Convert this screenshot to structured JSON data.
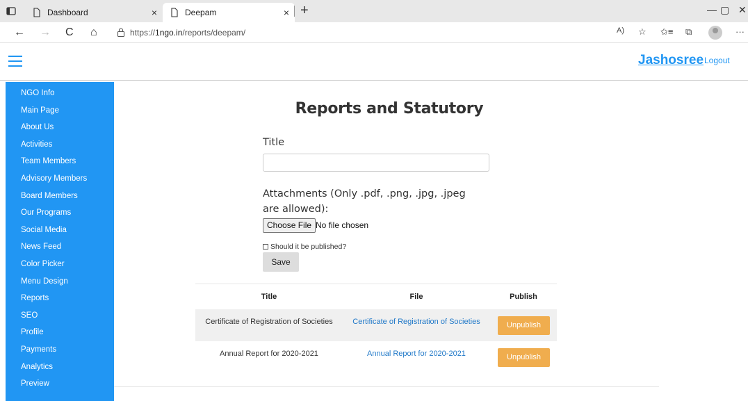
{
  "browser": {
    "tabs": [
      {
        "label": "Dashboard",
        "active": false
      },
      {
        "label": "Deepam",
        "active": true
      }
    ],
    "url_prefix": "https://",
    "url_domain": "1ngo.in",
    "url_path": "/reports/deepam/",
    "read_aloud": "A)",
    "glyphs": {
      "close": "×",
      "newtab": "+",
      "back": "←",
      "forward": "→",
      "reload": "C",
      "home": "⌂",
      "minimize": "—",
      "restore": "▢",
      "win_close": "✕",
      "favorite": "☆",
      "favorites": "✩≡",
      "collections": "⧉",
      "more": "···"
    }
  },
  "header": {
    "username": "Jashosree",
    "logout_label": "Logout"
  },
  "sidebar": {
    "items": [
      {
        "label": "NGO Info"
      },
      {
        "label": "Main Page"
      },
      {
        "label": "About Us"
      },
      {
        "label": "Activities"
      },
      {
        "label": "Team Members"
      },
      {
        "label": "Advisory Members"
      },
      {
        "label": "Board Members"
      },
      {
        "label": "Our Programs"
      },
      {
        "label": "Social Media"
      },
      {
        "label": "News Feed"
      },
      {
        "label": "Color Picker"
      },
      {
        "label": "Menu Design"
      },
      {
        "label": "Reports"
      },
      {
        "label": "SEO"
      },
      {
        "label": "Profile"
      },
      {
        "label": "Payments"
      },
      {
        "label": "Analytics"
      },
      {
        "label": "Preview"
      }
    ]
  },
  "main": {
    "page_title": "Reports and Statutory",
    "form": {
      "title_label": "Title",
      "title_value": "",
      "attachments_label": "Attachments (Only .pdf, .png, .jpg, .jpeg are allowed):",
      "choose_file_label": "Choose File",
      "no_file_text": "No file chosen",
      "publish_label": "Should it be published?",
      "publish_checked": false,
      "save_label": "Save"
    },
    "table": {
      "headers": [
        "Title",
        "File",
        "Publish"
      ],
      "rows": [
        {
          "title": "Certificate of Registration of Societies",
          "file": "Certificate of Registration of Societies",
          "action": "Unpublish"
        },
        {
          "title": "Annual Report for 2020-2021",
          "file": "Annual Report for 2020-2021",
          "action": "Unpublish"
        }
      ]
    }
  },
  "colors": {
    "accent": "#2196f3",
    "unpublish_button": "#f0ad4e",
    "link": "#1f78c8"
  }
}
